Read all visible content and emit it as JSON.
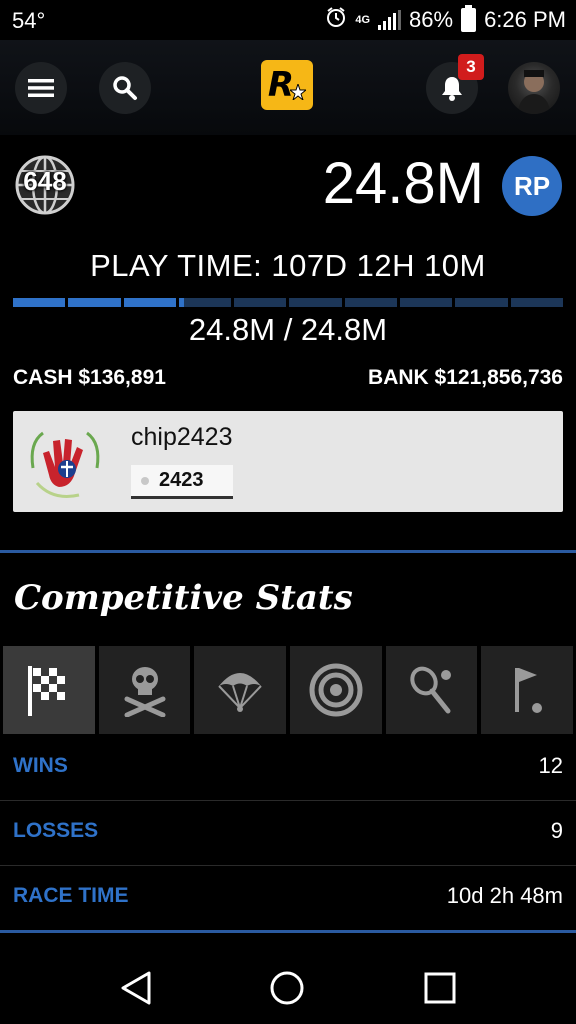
{
  "status_bar": {
    "temperature": "54°",
    "network": "4G",
    "battery": "86%",
    "time": "6:26 PM"
  },
  "topnav": {
    "notification_count": "3",
    "logo_letter": "R"
  },
  "player": {
    "rank": "648",
    "rp_value": "24.8M",
    "rp_badge": "RP",
    "play_time": "PLAY TIME: 107D 12H 10M",
    "rp_progress_text": "24.8M / 24.8M",
    "progress_fraction": 0.31,
    "progress_segments": 10,
    "cash": "CASH $136,891",
    "bank": "BANK $121,856,736"
  },
  "crew": {
    "name": "chip2423",
    "tag": "2423"
  },
  "competitive": {
    "title": "Competitive Stats",
    "tabs": [
      {
        "icon": "race-flag-icon",
        "active": true
      },
      {
        "icon": "skull-crossbones-icon",
        "active": false
      },
      {
        "icon": "parachute-icon",
        "active": false
      },
      {
        "icon": "target-icon",
        "active": false
      },
      {
        "icon": "tennis-icon",
        "active": false
      },
      {
        "icon": "golf-icon",
        "active": false
      }
    ],
    "rows": [
      {
        "label": "WINS",
        "value": "12"
      },
      {
        "label": "LOSSES",
        "value": "9"
      },
      {
        "label": "RACE TIME",
        "value": "10d 2h 48m"
      }
    ]
  },
  "colors": {
    "accent_blue": "#2f72c9",
    "logo_yellow": "#f6b716",
    "badge_red": "#d11c1c"
  }
}
